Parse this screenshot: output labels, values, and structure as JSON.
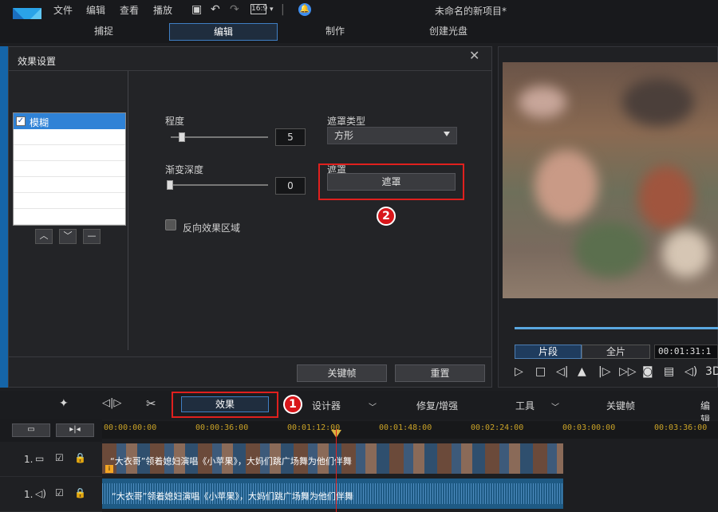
{
  "app": {
    "project_title": "未命名的新项目*"
  },
  "menu": [
    "文件",
    "编辑",
    "查看",
    "播放"
  ],
  "toolbar_icons": [
    "save-icon",
    "undo-icon",
    "redo-icon",
    "aspect-ratio-icon",
    "notification-icon"
  ],
  "aspect_ratio": "16:9",
  "mode_tabs": [
    "捕捉",
    "编辑",
    "制作",
    "创建光盘"
  ],
  "active_mode": "编辑",
  "dialog": {
    "title": "效果设置",
    "effects": [
      {
        "label": "模糊",
        "checked": true
      }
    ],
    "degree_label": "程度",
    "degree_value": "5",
    "gradient_label": "渐变深度",
    "gradient_value": "0",
    "mask_type_label": "遮罩类型",
    "mask_type_value": "方形",
    "mask_label": "遮罩",
    "mask_button": "遮罩",
    "invert_label": "反向效果区域",
    "keyframe_button": "关键帧",
    "reset_button": "重置",
    "list_buttons": [
      "move-up",
      "move-down",
      "remove"
    ]
  },
  "preview": {
    "segment_tab": "片段",
    "full_tab": "全片",
    "timecode": "00:01:31:1",
    "controls": [
      "play",
      "stop",
      "prev-frame",
      "split",
      "next-frame",
      "fast-forward",
      "snapshot",
      "subtitle",
      "volume",
      "3D"
    ],
    "three_d": "3D"
  },
  "edit_toolbar": {
    "effects_button": "效果",
    "designer": "设计器",
    "repair": "修复/增强",
    "tools": "工具",
    "keyframe": "关键帧",
    "edit": "编辑"
  },
  "callouts": {
    "one": "1",
    "two": "2"
  },
  "ruler_ticks": [
    "00:00:00:00",
    "00:00:36:00",
    "00:01:12:00",
    "00:01:48:00",
    "00:02:24:00",
    "00:03:00:00",
    "00:03:36:00"
  ],
  "tracks": [
    {
      "number": "1.",
      "type": "video",
      "clip": "“大衣哥”领着媳妇演唱《小苹果》，大妈们跳广场舞为他们伴舞"
    },
    {
      "number": "1.",
      "type": "audio",
      "clip": "“大衣哥”领着媳妇演唱《小苹果》，大妈们跳广场舞为他们伴舞"
    }
  ],
  "colors": {
    "accent": "#3f7fc4",
    "callout_red": "#e0201e",
    "selection": "#2f82d6"
  }
}
